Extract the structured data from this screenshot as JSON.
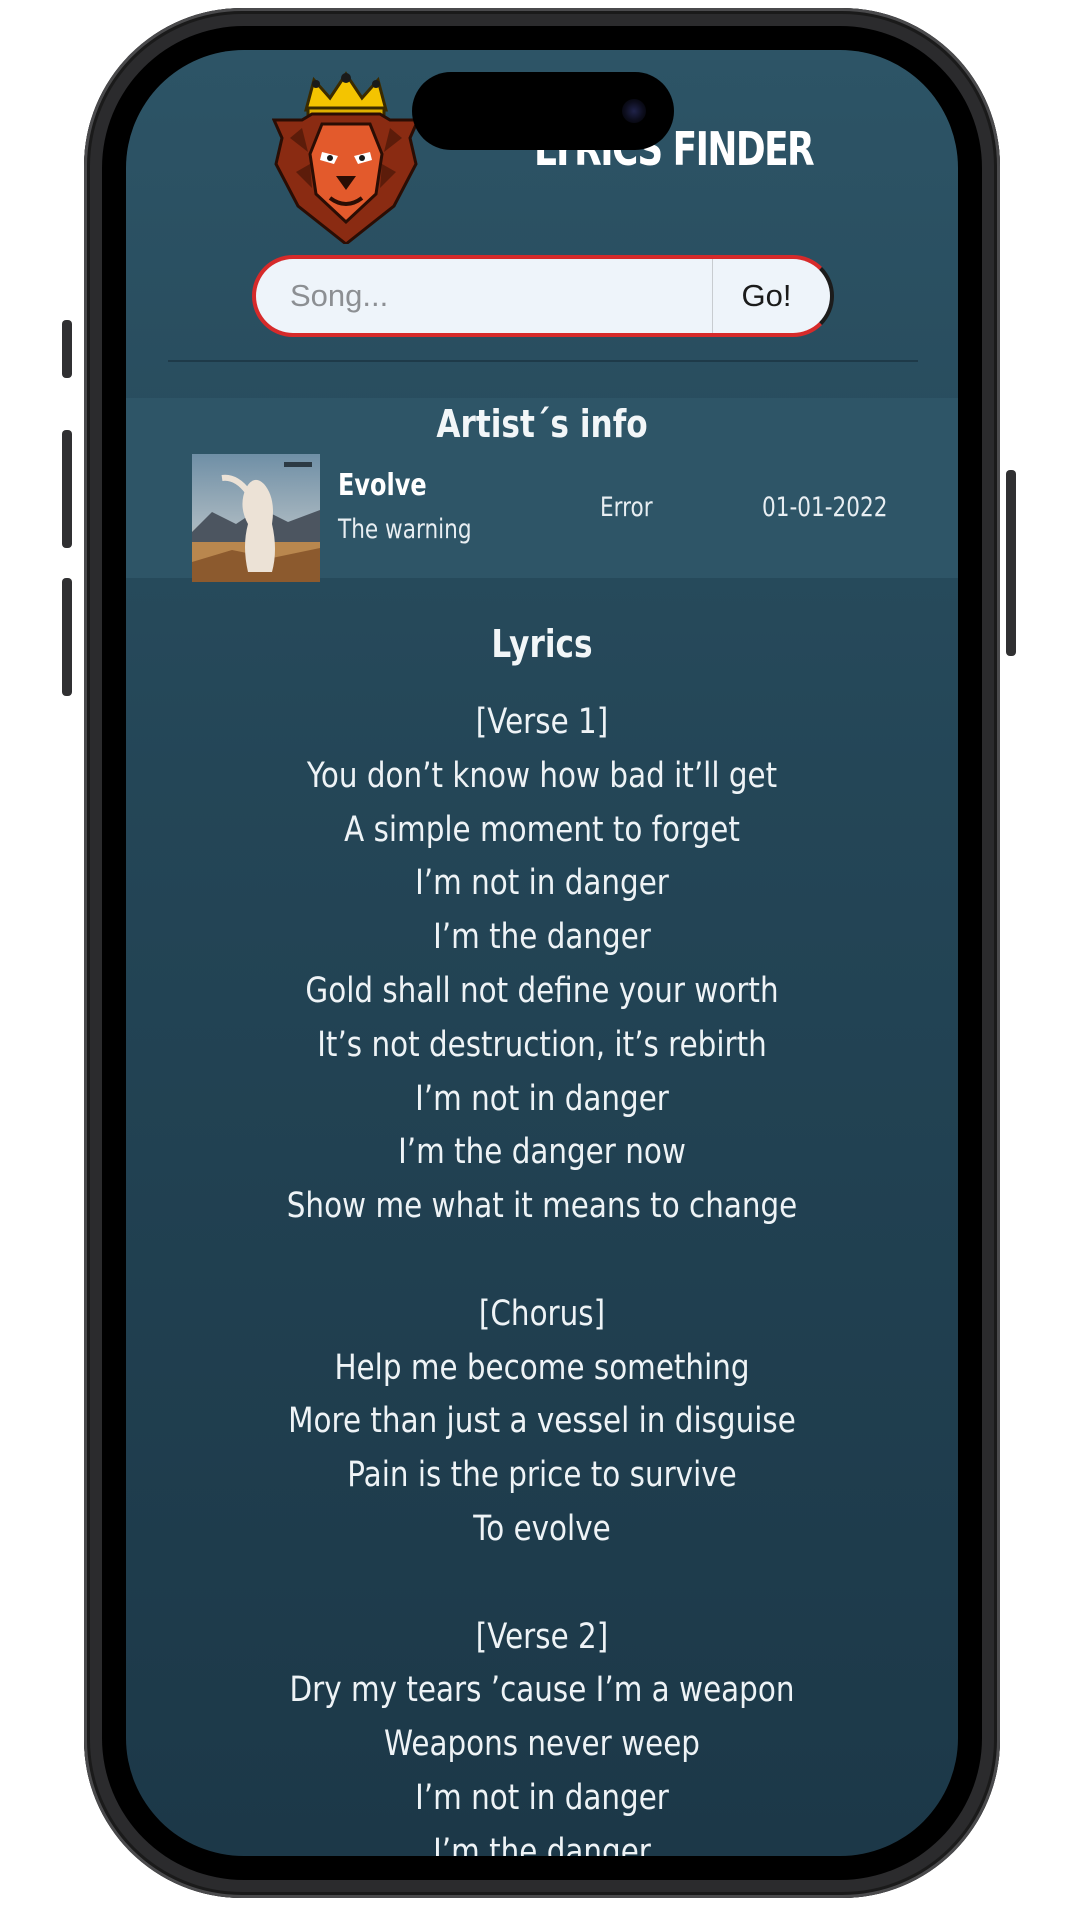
{
  "app": {
    "title": "LYRICS FINDER",
    "logo_icon": "crowned-lion-icon"
  },
  "search": {
    "placeholder": "Song...",
    "value": "",
    "button_label": "Go!"
  },
  "artist_info": {
    "heading": "Artist´s info",
    "cover_image": "album-cover-image",
    "song_title": "Evolve",
    "artist": "The warning",
    "status": "Error",
    "date": "01-01-2022"
  },
  "lyrics": {
    "heading": "Lyrics",
    "lines": [
      "[Verse 1]",
      "You don’t know how bad it’ll get",
      "A simple moment to forget",
      "I’m not in danger",
      "I’m the danger",
      "Gold shall not define your worth",
      "It’s not destruction, it’s rebirth",
      "I’m not in danger",
      "I’m the danger now",
      "Show me what it means to change",
      "",
      "[Chorus]",
      "Help me become something",
      "More than just a vessel in disguise",
      "Pain is the price to survive",
      "To evolve",
      "",
      "[Verse 2]",
      "Dry my tears ’cause I’m a weapon",
      "Weapons never weep",
      "I’m not in danger",
      "I’m the danger"
    ]
  },
  "colors": {
    "background_top": "#2d5466",
    "background_bottom": "#1c3848",
    "panel": "#2e5567",
    "search_border": "#d62a2a"
  }
}
